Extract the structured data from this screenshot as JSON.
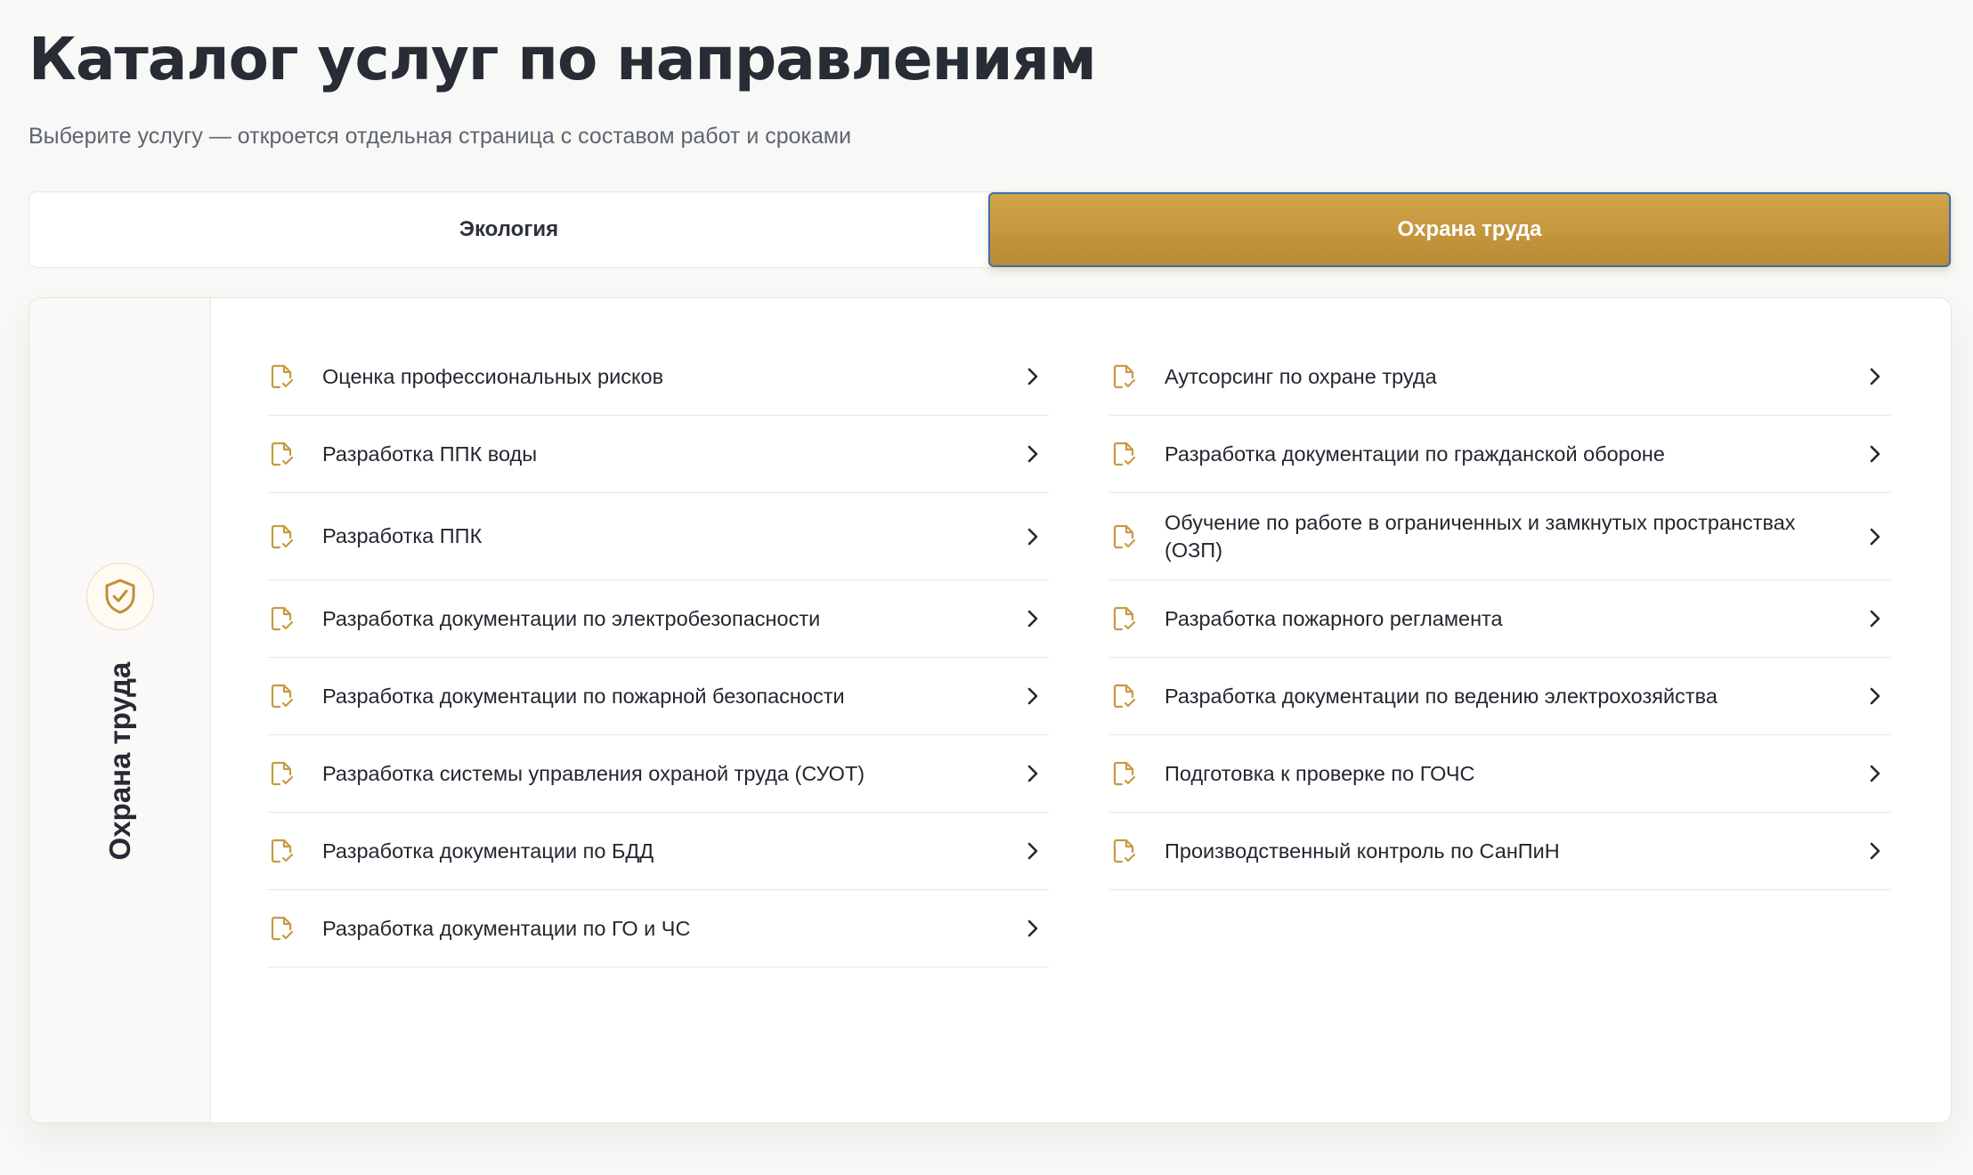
{
  "header": {
    "title": "Каталог услуг по направлениям",
    "subtitle": "Выберите услугу — откроется отдельная страница с составом работ и сроками"
  },
  "tabs": [
    {
      "label": "Экология",
      "active": false
    },
    {
      "label": "Охрана труда",
      "active": true
    }
  ],
  "panel": {
    "side_icon": "shield-check-icon",
    "side_label": "Охрана труда",
    "item_icon": "document-check-icon",
    "item_chevron": "chevron-right-icon",
    "left_items": [
      "Оценка профессиональных рисков",
      "Разработка ППК воды",
      "Разработка ППК",
      "Разработка документации по электробезопасности",
      "Разработка документации по пожарной безопасности",
      "Разработка системы управления охраной труда (СУОТ)",
      "Разработка документации по БДД",
      "Разработка документации по ГО и ЧС"
    ],
    "right_items": [
      "Аутсорсинг по охране труда",
      "Разработка документации по гражданской обороне",
      "Обучение по работе в ограниченных и замкнутых пространствах (ОЗП)",
      "Разработка пожарного регламента",
      "Разработка документации по ведению электрохозяйства",
      "Подготовка к проверке по ГОЧС",
      "Производственный контроль по СанПиН"
    ]
  },
  "colors": {
    "accent": "#c79a42",
    "accent_dark": "#b98a34",
    "text": "#252a33",
    "muted": "#5e6470",
    "active_tab_outline": "#3c6fb0"
  }
}
